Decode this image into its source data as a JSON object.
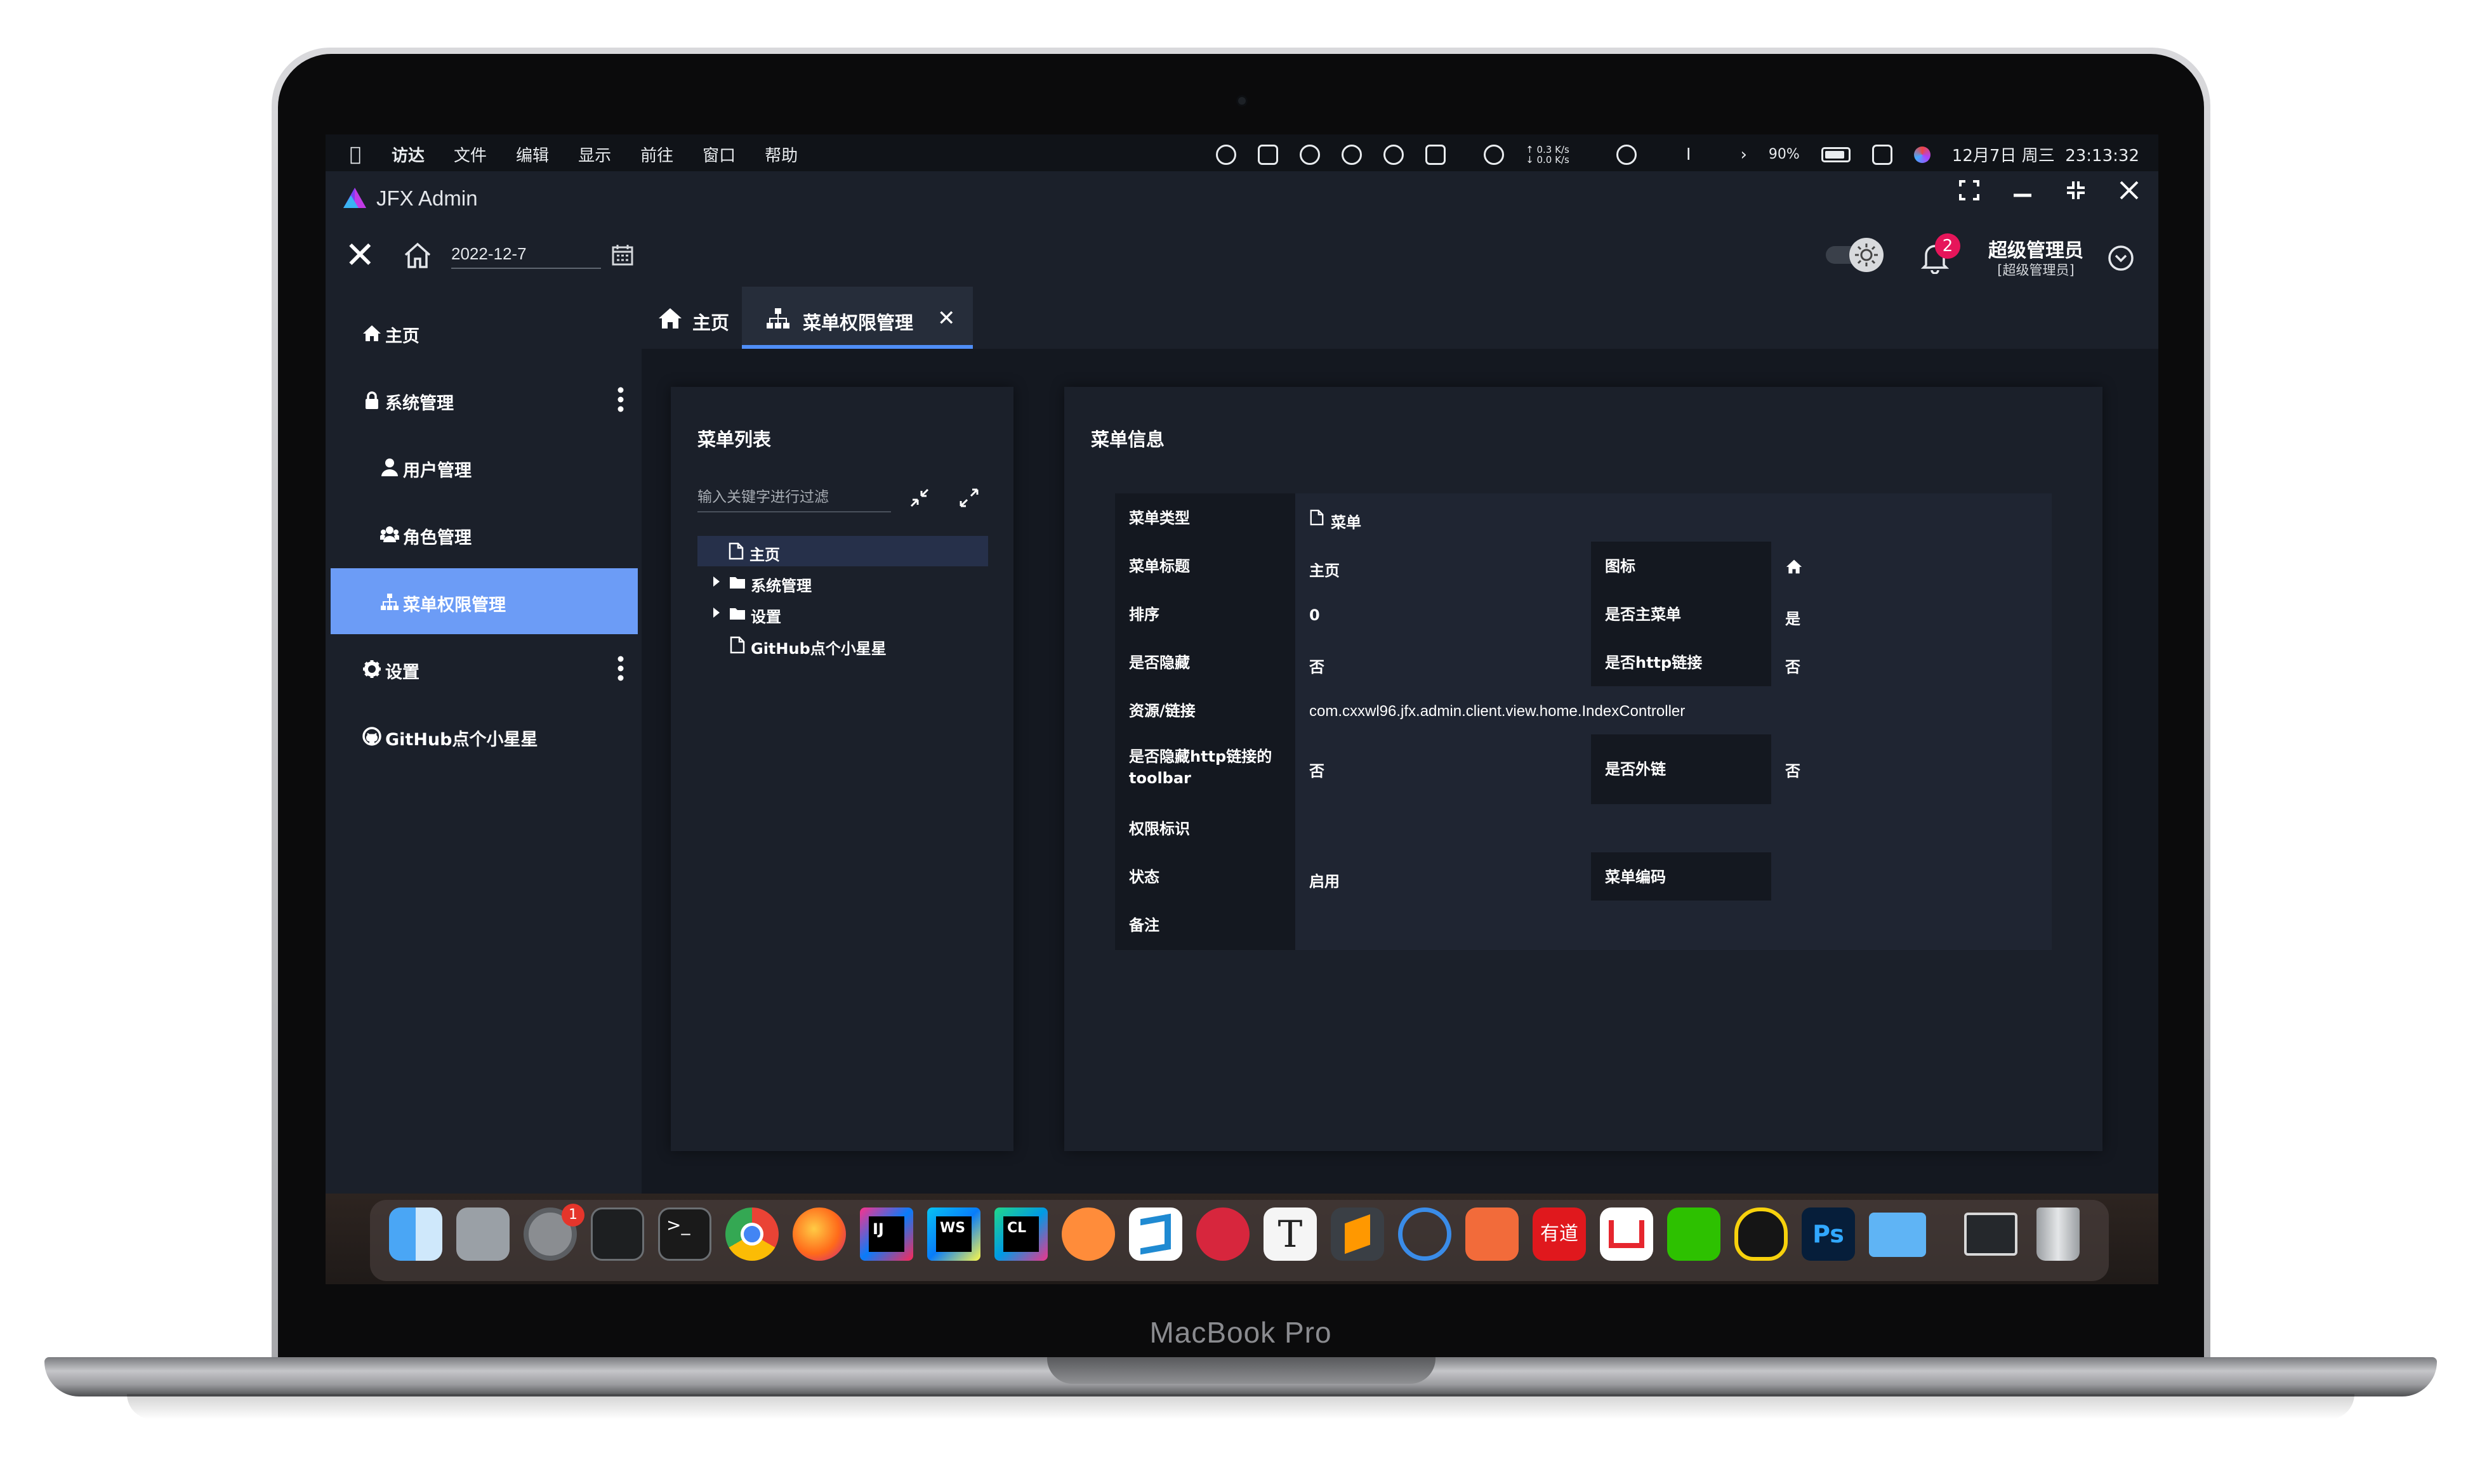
{
  "device": {
    "brand_label": "MacBook Pro"
  },
  "menubar": {
    "app_name": "访达",
    "menus": [
      "文件",
      "编辑",
      "显示",
      "前往",
      "窗口",
      "帮助"
    ],
    "net_up": "↑ 0.3 K/s",
    "net_down": "↓ 0.0 K/s",
    "separator": "I",
    "battery": "90%",
    "clock": "12月7日 周三  23:13:32"
  },
  "window": {
    "title": "JFX Admin"
  },
  "header": {
    "date_value": "2022-12-7",
    "notification_count": "2",
    "user_name": "超级管理员",
    "user_role": "[超级管理员]"
  },
  "sidebar": {
    "items": [
      {
        "label": "主页",
        "icon": "home-icon"
      },
      {
        "label": "系统管理",
        "icon": "lock-icon"
      },
      {
        "label": "用户管理",
        "icon": "user-icon"
      },
      {
        "label": "角色管理",
        "icon": "users-icon"
      },
      {
        "label": "菜单权限管理",
        "icon": "sitemap-icon",
        "active": true
      },
      {
        "label": "设置",
        "icon": "gear-icon"
      },
      {
        "label": "GitHub点个小星星",
        "icon": "github-icon"
      }
    ]
  },
  "tabs": [
    {
      "label": "主页",
      "icon": "home-icon"
    },
    {
      "label": "菜单权限管理",
      "icon": "sitemap-icon",
      "active": true
    }
  ],
  "menu_list": {
    "title": "菜单列表",
    "filter_placeholder": "输入关键字进行过滤",
    "tree": [
      {
        "label": "主页",
        "type": "file",
        "selected": true
      },
      {
        "label": "系统管理",
        "type": "folder",
        "expandable": true
      },
      {
        "label": "设置",
        "type": "folder",
        "expandable": true
      },
      {
        "label": "GitHub点个小星星",
        "type": "file"
      }
    ]
  },
  "menu_info": {
    "title": "菜单信息",
    "menu_type_label": "菜单类型",
    "menu_type_value": "菜单",
    "menu_title_label": "菜单标题",
    "menu_title_value": "主页",
    "icon_label": "图标",
    "icon_value": "home-icon",
    "sort_label": "排序",
    "sort_value": "0",
    "is_main_label": "是否主菜单",
    "is_main_value": "是",
    "hidden_label": "是否隐藏",
    "hidden_value": "否",
    "is_http_label": "是否http链接",
    "is_http_value": "否",
    "resource_label": "资源/链接",
    "resource_value": "com.cxxwl96.jfx.admin.client.view.home.IndexController",
    "hide_toolbar_label": "是否隐藏http链接的toolbar",
    "hide_toolbar_value": "否",
    "external_label": "是否外链",
    "external_value": "否",
    "permission_label": "权限标识",
    "permission_value": "",
    "status_label": "状态",
    "status_value": "启用",
    "code_label": "菜单编码",
    "code_value": "",
    "remark_label": "备注",
    "remark_value": ""
  },
  "dock": {
    "badge_count": "1",
    "apps": [
      "finder-icon",
      "launchpad-icon",
      "system-preferences-icon",
      "activity-monitor-icon",
      "terminal-icon",
      "chrome-icon",
      "firefox-icon",
      "intellij-icon",
      "webstorm-icon",
      "clion-icon",
      "app-icon",
      "vscode-icon",
      "app-icon",
      "typora-icon",
      "sublime-text-icon",
      "app-icon",
      "pencil-app-icon",
      "youdao-icon",
      "wps-icon",
      "wechat-icon",
      "qq-icon",
      "photoshop-icon",
      "folder-icon",
      "window-icon",
      "trash-icon"
    ],
    "youdao_label": "有道",
    "typora_label": "T",
    "ps_label": "Ps"
  },
  "colors": {
    "accent": "#4f8ef7",
    "active_nav": "#6c9cf6",
    "badge": "#e6155a",
    "background": "#15191f",
    "panel": "#1b202a"
  }
}
